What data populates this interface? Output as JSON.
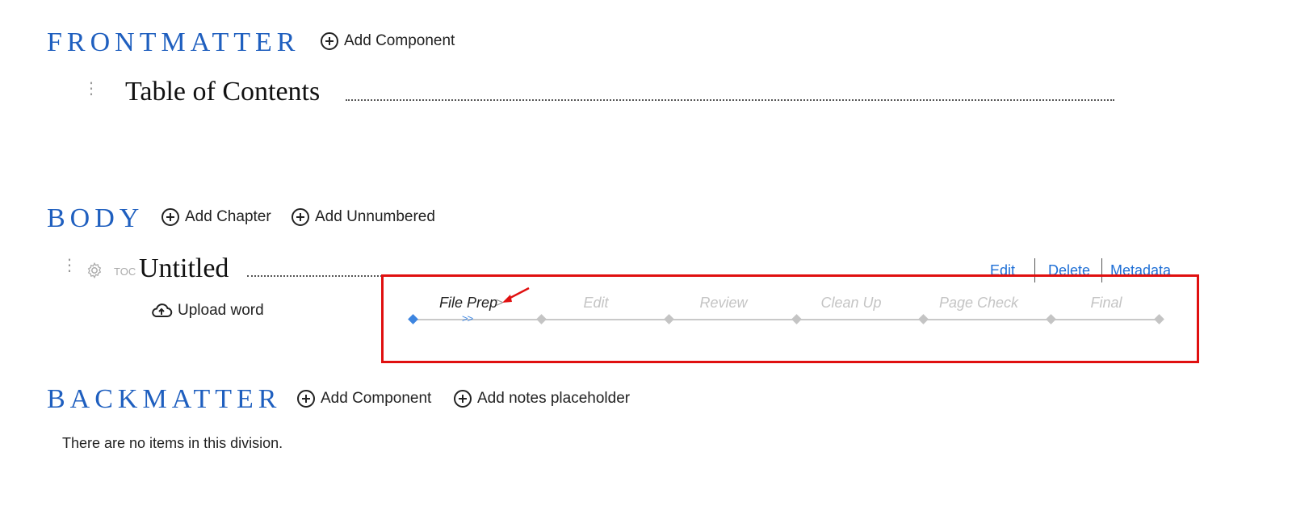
{
  "frontmatter": {
    "title": "FRONTMATTER",
    "add_component_label": "Add Component",
    "items": [
      {
        "title": "Table of Contents"
      }
    ]
  },
  "body": {
    "title": "BODY",
    "add_chapter_label": "Add Chapter",
    "add_unnumbered_label": "Add Unnumbered",
    "chapter": {
      "toc_label": "TOC",
      "title": "Untitled",
      "upload_label": "Upload word",
      "actions": {
        "edit": "Edit",
        "delete": "Delete",
        "metadata": "Metadata"
      },
      "workflow": {
        "stages": [
          "File Prep",
          "Edit",
          "Review",
          "Clean Up",
          "Page Check",
          "Final"
        ],
        "active_stage": "File Prep",
        "active_suffix": ">",
        "progress_marker": ">>"
      }
    }
  },
  "backmatter": {
    "title": "BACKMATTER",
    "add_component_label": "Add Component",
    "add_notes_label": "Add notes placeholder",
    "empty_message": "There are no items in this division."
  },
  "colors": {
    "accent": "#1f5fbf",
    "link": "#1f6fd6",
    "highlight_box": "#e01010",
    "workflow_active": "#3d85e0",
    "workflow_inactive": "#c4c4c4"
  }
}
